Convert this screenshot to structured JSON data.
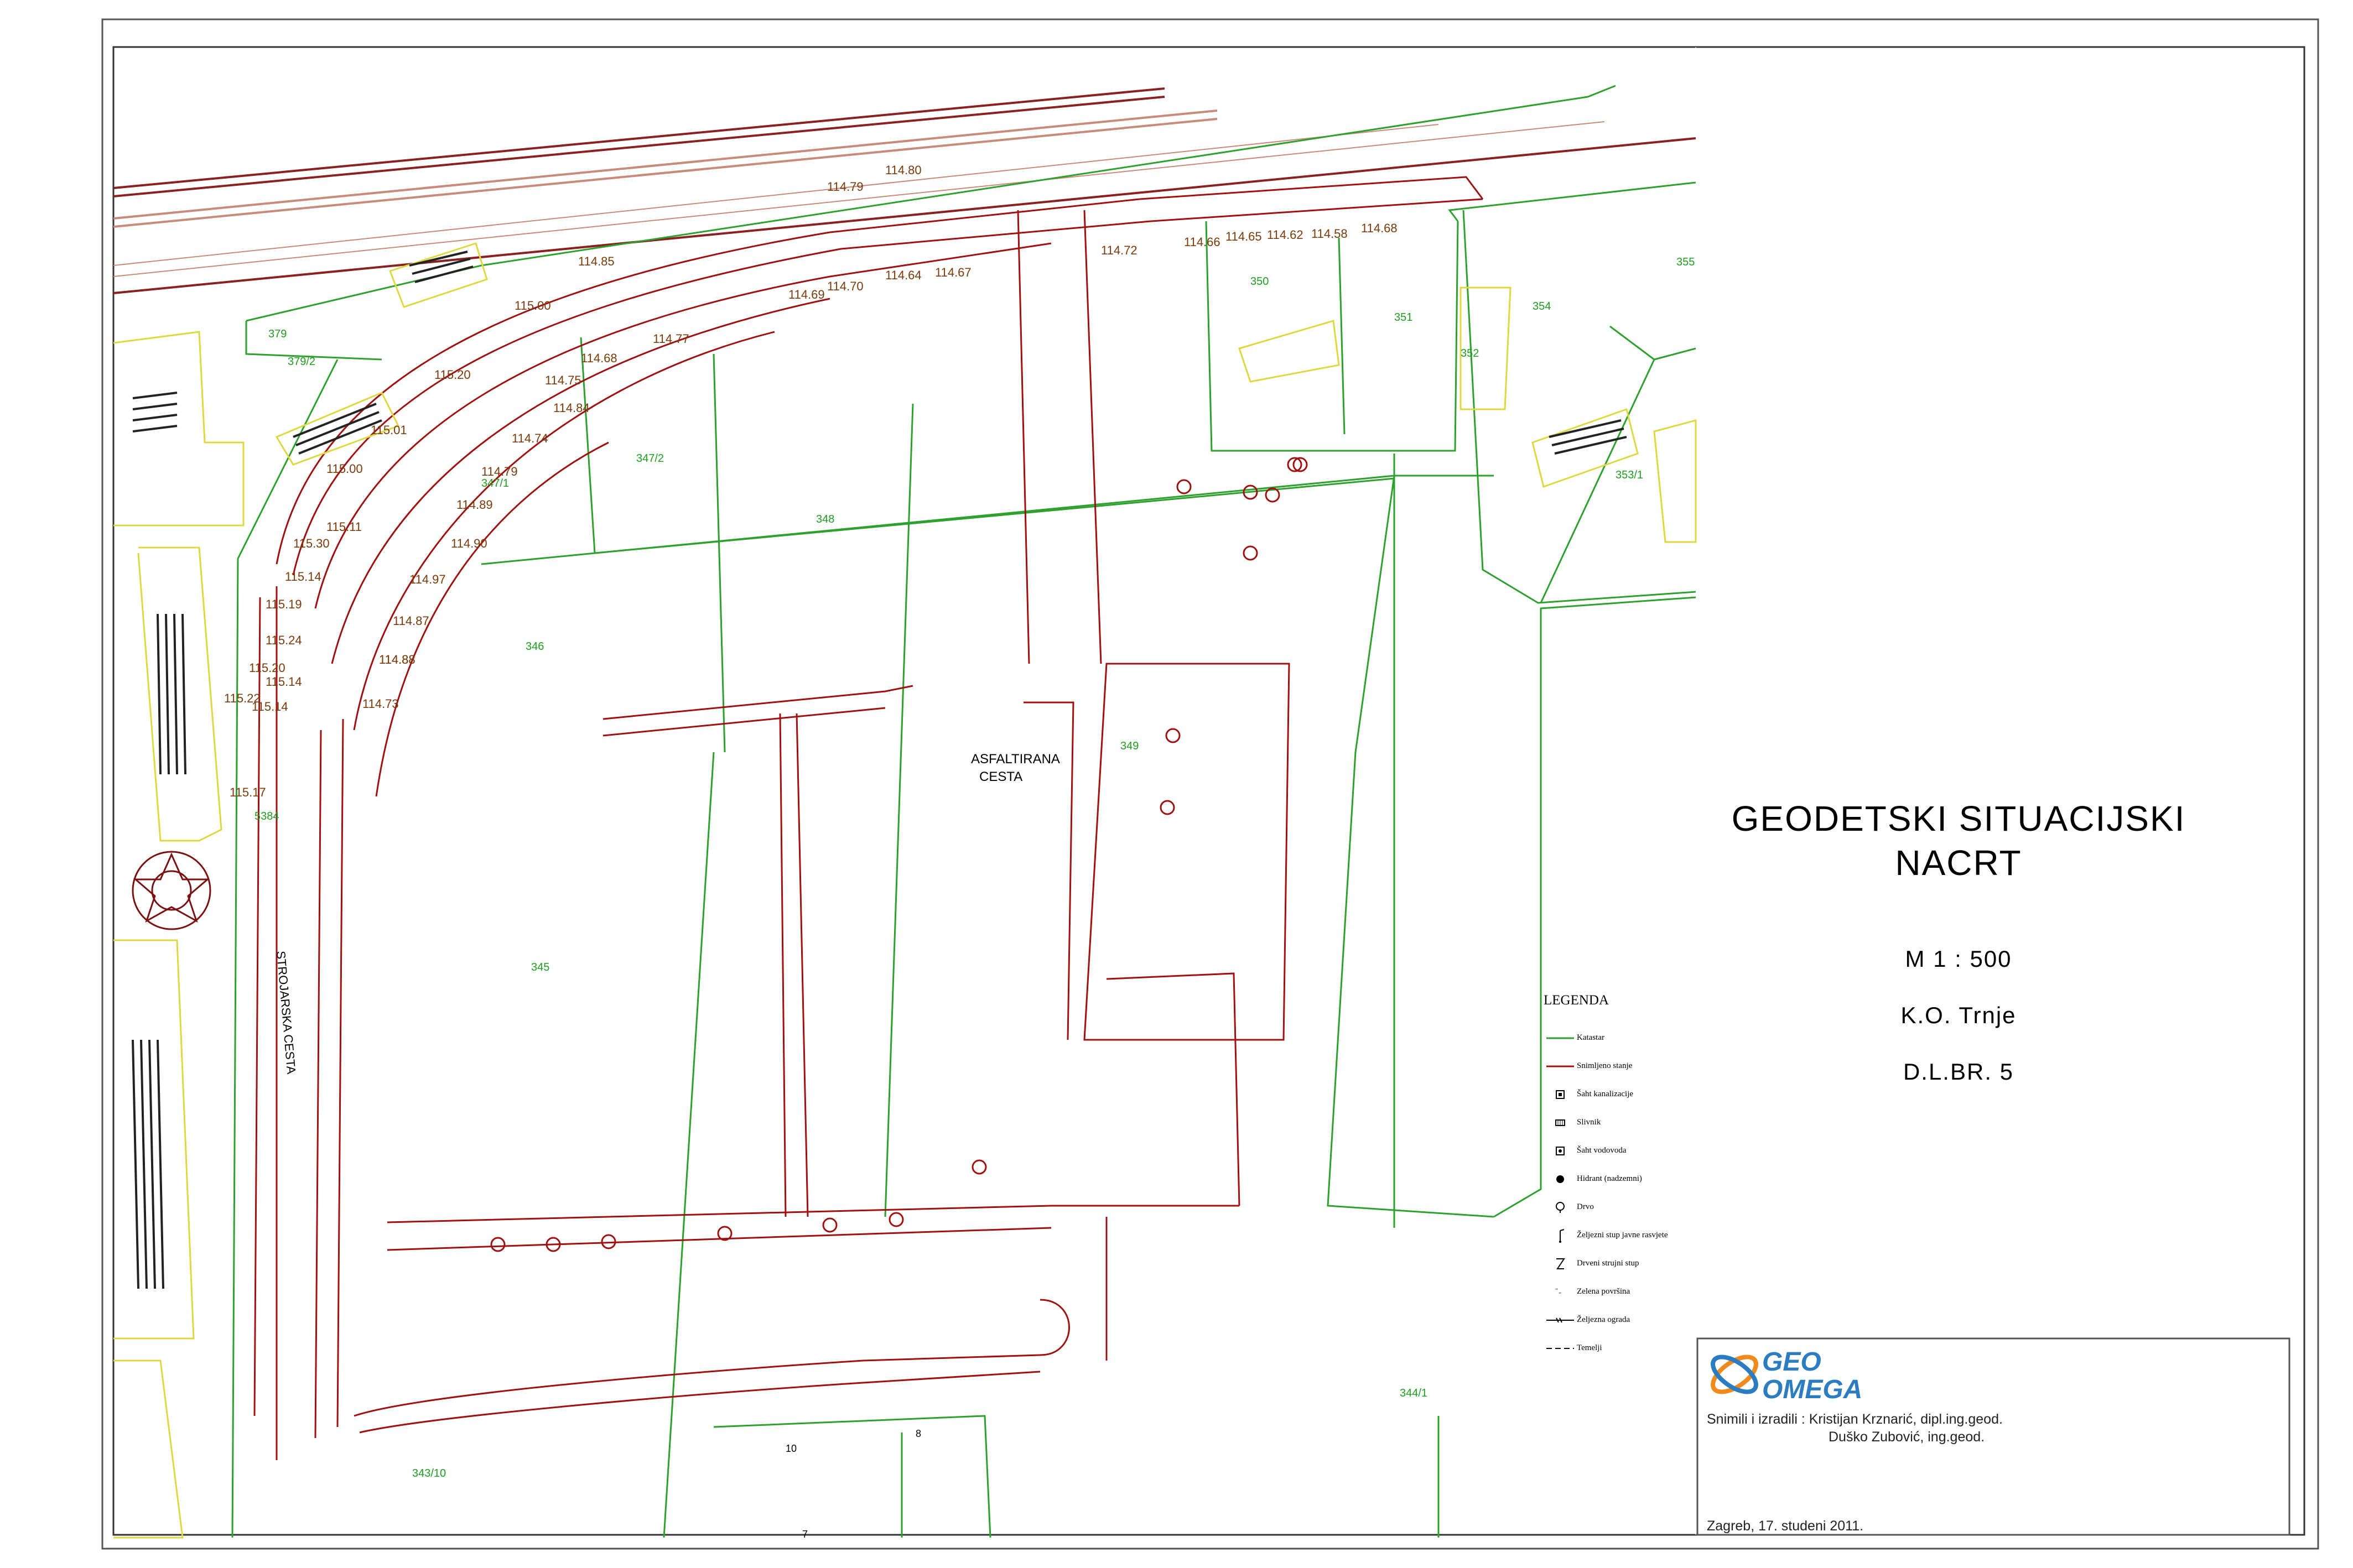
{
  "title": {
    "line1": "GEODETSKI SITUACIJSKI",
    "line2": "NACRT",
    "scale": "M 1 : 500",
    "cadastral_municipality": "K.O. Trnje",
    "sheet_number": "D.L.BR. 5"
  },
  "legend": {
    "title": "LEGENDA",
    "items": [
      {
        "label": "Katastar",
        "icon": "katastar-line-icon"
      },
      {
        "label": "Snimljeno stanje",
        "icon": "surveyed-line-icon"
      },
      {
        "label": "Šaht kanalizacije",
        "icon": "sewer-manhole-icon"
      },
      {
        "label": "Slivnik",
        "icon": "drain-icon"
      },
      {
        "label": "Šaht vodovoda",
        "icon": "water-manhole-icon"
      },
      {
        "label": "Hidrant (nadzemni)",
        "icon": "hydrant-icon"
      },
      {
        "label": "Drvo",
        "icon": "tree-icon"
      },
      {
        "label": "Željezni stup javne rasvjete",
        "icon": "street-light-icon"
      },
      {
        "label": "Drveni strujni stup",
        "icon": "wooden-pole-icon"
      },
      {
        "label": "Zelena površina",
        "icon": "green-area-icon"
      },
      {
        "label": "Željezna ograda",
        "icon": "iron-fence-icon"
      },
      {
        "label": "Temelji",
        "icon": "foundation-icon"
      }
    ]
  },
  "credits": {
    "line1": "Snimili i izradili : Kristijan Krznarić, dipl.ing.geod.",
    "line2": "Duško Zubović, ing.geod.",
    "date": "Zagreb, 17. studeni 2011."
  },
  "logo": {
    "line1": "GEO",
    "line2": "OMEGA"
  },
  "map": {
    "street_label": "STROJARSKA CESTA",
    "road_label_1": "ASFALTIRANA",
    "road_label_2": "CESTA",
    "parcels": [
      {
        "label": "379"
      },
      {
        "label": "379/2"
      },
      {
        "label": "347/2"
      },
      {
        "label": "347/1"
      },
      {
        "label": "348"
      },
      {
        "label": "346"
      },
      {
        "label": "345"
      },
      {
        "label": "349"
      },
      {
        "label": "350"
      },
      {
        "label": "351"
      },
      {
        "label": "352"
      },
      {
        "label": "354"
      },
      {
        "label": "355"
      },
      {
        "label": "353/1"
      },
      {
        "label": "344/1"
      },
      {
        "label": "343/10"
      },
      {
        "label": "5384"
      }
    ],
    "building_numbers": [
      {
        "label": "10"
      },
      {
        "label": "8"
      },
      {
        "label": "7"
      }
    ],
    "elevations": [
      {
        "label": "114.80"
      },
      {
        "label": "114.79"
      },
      {
        "label": "114.85"
      },
      {
        "label": "115.00"
      },
      {
        "label": "114.77"
      },
      {
        "label": "114.68"
      },
      {
        "label": "114.75"
      },
      {
        "label": "114.74"
      },
      {
        "label": "114.84"
      },
      {
        "label": "114.70"
      },
      {
        "label": "114.69"
      },
      {
        "label": "114.67"
      },
      {
        "label": "114.64"
      },
      {
        "label": "114.72"
      },
      {
        "label": "114.66"
      },
      {
        "label": "114.65"
      },
      {
        "label": "114.62"
      },
      {
        "label": "114.58"
      },
      {
        "label": "114.68"
      },
      {
        "label": "115.20"
      },
      {
        "label": "114.88"
      },
      {
        "label": "115.01"
      },
      {
        "label": "115.00"
      },
      {
        "label": "115.11"
      },
      {
        "label": "115.30"
      },
      {
        "label": "115.14"
      },
      {
        "label": "115.19"
      },
      {
        "label": "115.24"
      },
      {
        "label": "115.20"
      },
      {
        "label": "115.14"
      },
      {
        "label": "115.22"
      },
      {
        "label": "115.14"
      },
      {
        "label": "115.17"
      },
      {
        "label": "114.97"
      },
      {
        "label": "114.87"
      },
      {
        "label": "114.88"
      },
      {
        "label": "114.73"
      },
      {
        "label": "114.79"
      },
      {
        "label": "114.90"
      },
      {
        "label": "114.89"
      }
    ]
  },
  "colors": {
    "survey": "#a01010",
    "cadastre": "#2ea02e",
    "rail": "#8a2020",
    "building": "#e0d840",
    "elevation_text": "#7a3a0a",
    "parcel_text": "#1e9e1e",
    "logo": "#2b7cc1",
    "logo_accent": "#f08a1c"
  }
}
